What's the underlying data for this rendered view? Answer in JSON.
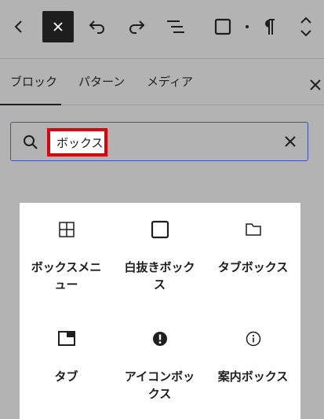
{
  "tabs": [
    {
      "label": "ブロック",
      "active": true
    },
    {
      "label": "パターン",
      "active": false
    },
    {
      "label": "メディア",
      "active": false
    }
  ],
  "search": {
    "value": "ボックス",
    "placeholder": ""
  },
  "blocks": [
    {
      "label": "ボックスメニュー",
      "icon": "grid-icon"
    },
    {
      "label": "白抜きボックス",
      "icon": "square-icon"
    },
    {
      "label": "タブボックス",
      "icon": "folder-icon"
    },
    {
      "label": "タブ",
      "icon": "tab-window-icon"
    },
    {
      "label": "アイコンボックス",
      "icon": "exclamation-circle-icon"
    },
    {
      "label": "案内ボックス",
      "icon": "info-circle-icon"
    }
  ],
  "colors": {
    "background": "#b3b3b3",
    "panel": "#ffffff",
    "search_border": "#3f4fb0",
    "highlight": "#e0000a",
    "text": "#1e1e1e"
  }
}
